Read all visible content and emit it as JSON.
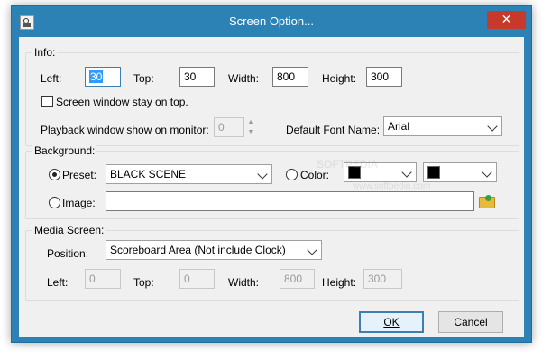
{
  "window": {
    "title": "Screen Option...",
    "close_label": "✕"
  },
  "info": {
    "legend": "Info:",
    "left_label": "Left:",
    "left_value": "30",
    "top_label": "Top:",
    "top_value": "30",
    "width_label": "Width:",
    "width_value": "800",
    "height_label": "Height:",
    "height_value": "300",
    "stay_on_top_label": "Screen window stay on top.",
    "stay_on_top_checked": false,
    "monitor_label": "Playback window show on monitor:",
    "monitor_value": "0",
    "font_label": "Default Font Name:",
    "font_value": "Arial"
  },
  "background": {
    "legend": "Background:",
    "preset_label": "Preset:",
    "preset_value": "BLACK SCENE",
    "color_label": "Color:",
    "color1_value": "clBlack",
    "color2_value": "clBlack",
    "swatch_color": "#000000",
    "image_label": "Image:",
    "image_value": ""
  },
  "media": {
    "legend": "Media Screen:",
    "position_label": "Position:",
    "position_value": "Scoreboard Area (Not include Clock)",
    "left_label": "Left:",
    "left_value": "0",
    "top_label": "Top:",
    "top_value": "0",
    "width_label": "Width:",
    "width_value": "800",
    "height_label": "Height:",
    "height_value": "300"
  },
  "buttons": {
    "ok_label": "OK",
    "cancel_label": "Cancel"
  },
  "watermark": {
    "text1": "SOFTPEDIA",
    "text2": "www.softpedia.com"
  },
  "colors": {
    "titlebar": "#2d82b5",
    "close_button": "#c7392b",
    "dialog_bg": "#f0f0f0",
    "focus": "#3c7fb1"
  }
}
